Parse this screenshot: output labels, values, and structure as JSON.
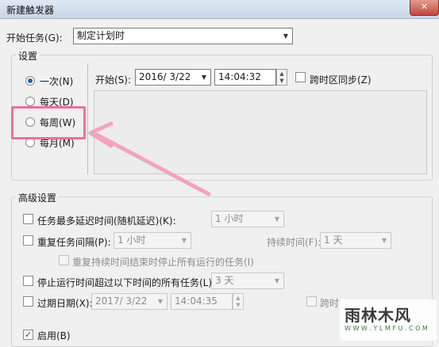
{
  "window": {
    "title": "新建触发器",
    "close_glyph": "✕"
  },
  "start_task": {
    "label": "开始任务(G):",
    "value": "制定计划时"
  },
  "settings": {
    "group_label": "设置",
    "schedule_options": [
      {
        "label": "一次(N)",
        "checked": true
      },
      {
        "label": "每天(D)",
        "checked": false
      },
      {
        "label": "每周(W)",
        "checked": false
      },
      {
        "label": "每月(M)",
        "checked": false
      }
    ],
    "start_label": "开始(S):",
    "start_date": "2016/  3/22",
    "start_time": "14:04:32",
    "sync_timezone_label": "跨时区同步(Z)"
  },
  "advanced": {
    "group_label": "高级设置",
    "delay": {
      "label": "任务最多延迟时间(随机延迟)(K):",
      "value": "1 小时"
    },
    "repeat": {
      "label": "重复任务间隔(P):",
      "value": "1 小时",
      "duration_label": "持续时间(F):",
      "duration_value": "1 天"
    },
    "stop_running": {
      "label": "重复持续时间结束时停止所有运行的任务(I)"
    },
    "stop_if_longer": {
      "label": "停止运行时间超过以下时间的所有任务(L):",
      "value": "3 天"
    },
    "expire": {
      "label": "过期日期(X):",
      "date": "2017/  3/22",
      "time": "14:04:35",
      "sync_label_partial": "跨时"
    },
    "enabled": {
      "label": "启用(B)",
      "checked": true
    }
  },
  "watermark": {
    "brand": "雨林木风",
    "url": "W W W . Y L M F U . C O M"
  },
  "colors": {
    "highlight": "#ee6f9d",
    "accent": "#2b5ea8"
  }
}
